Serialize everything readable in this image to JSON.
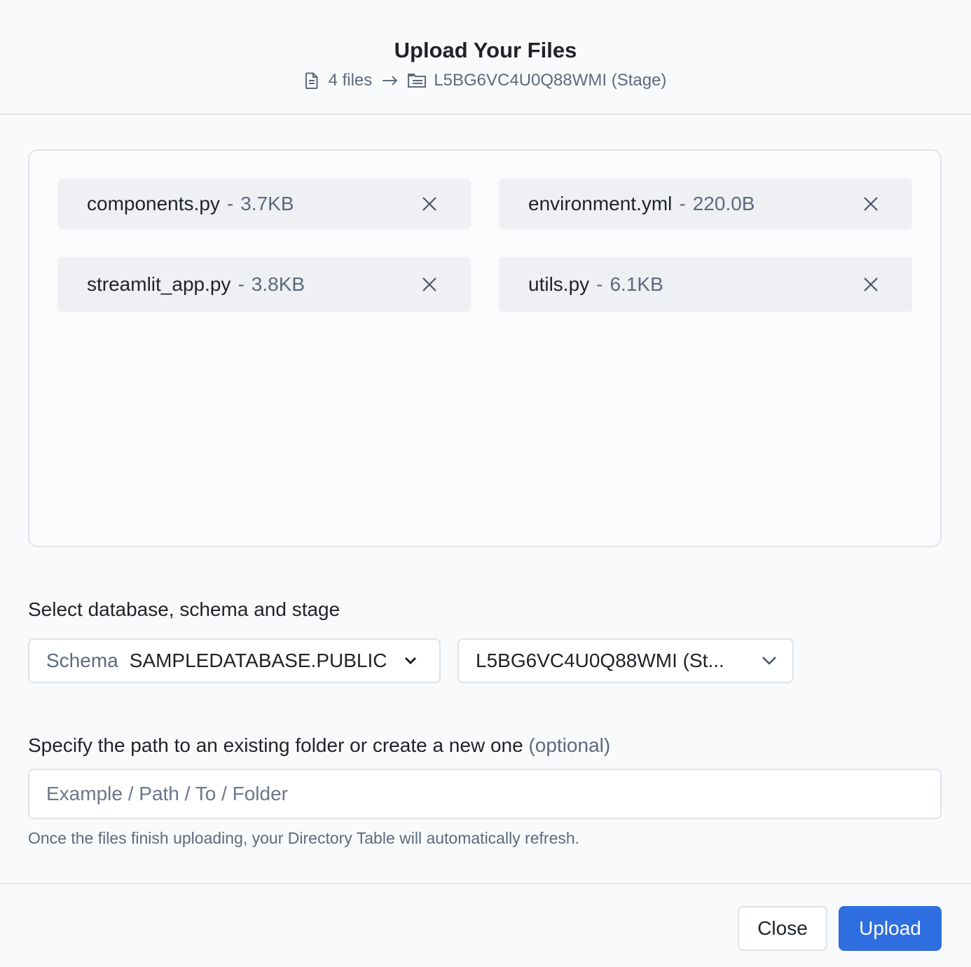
{
  "header": {
    "title": "Upload Your Files",
    "file_count": "4 files",
    "destination": "L5BG6VC4U0Q88WMI (Stage)",
    "icons": [
      "file-icon",
      "arrow-right-icon",
      "stage-folder-icon"
    ]
  },
  "files": [
    {
      "name": "components.py",
      "separator": "-",
      "size": "3.7KB"
    },
    {
      "name": "environment.yml",
      "separator": "-",
      "size": "220.0B"
    },
    {
      "name": "streamlit_app.py",
      "separator": "-",
      "size": "3.8KB"
    },
    {
      "name": "utils.py",
      "separator": "-",
      "size": "6.1KB"
    }
  ],
  "location": {
    "label": "Select database, schema and stage",
    "schema_prefix": "Schema",
    "schema_value": "SAMPLEDATABASE.PUBLIC",
    "stage_value": "L5BG6VC4U0Q88WMI (St..."
  },
  "path": {
    "label": "Specify the path to an existing folder or create a new one",
    "optional": "(optional)",
    "placeholder": "Example / Path / To / Folder",
    "value": "",
    "hint": "Once the files finish uploading, your Directory Table will automatically refresh."
  },
  "buttons": {
    "close": "Close",
    "upload": "Upload"
  },
  "colors": {
    "primary": "#2f6ee0",
    "muted_text": "#5d6a7e",
    "chip_bg": "#eef0f4"
  }
}
